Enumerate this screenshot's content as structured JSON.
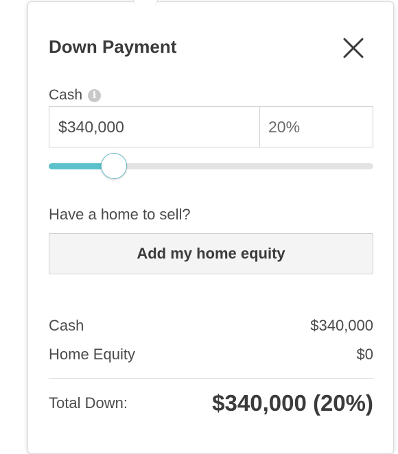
{
  "dialog": {
    "title": "Down Payment",
    "close_icon": "close-icon"
  },
  "cash_input": {
    "label": "Cash",
    "info_icon": "info-icon",
    "info_glyph": "i",
    "amount_value": "$340,000",
    "percent_value": "20%"
  },
  "slider": {
    "value_fraction": 0.2,
    "fill_color": "#5bc2cc",
    "track_color": "#e3e3e3"
  },
  "home_equity": {
    "question": "Have a home to sell?",
    "button_label": "Add my home equity"
  },
  "summary": {
    "rows": [
      {
        "label": "Cash",
        "value": "$340,000"
      },
      {
        "label": "Home Equity",
        "value": "$0"
      }
    ],
    "total_label": "Total Down:",
    "total_value": "$340,000 (20%)"
  }
}
